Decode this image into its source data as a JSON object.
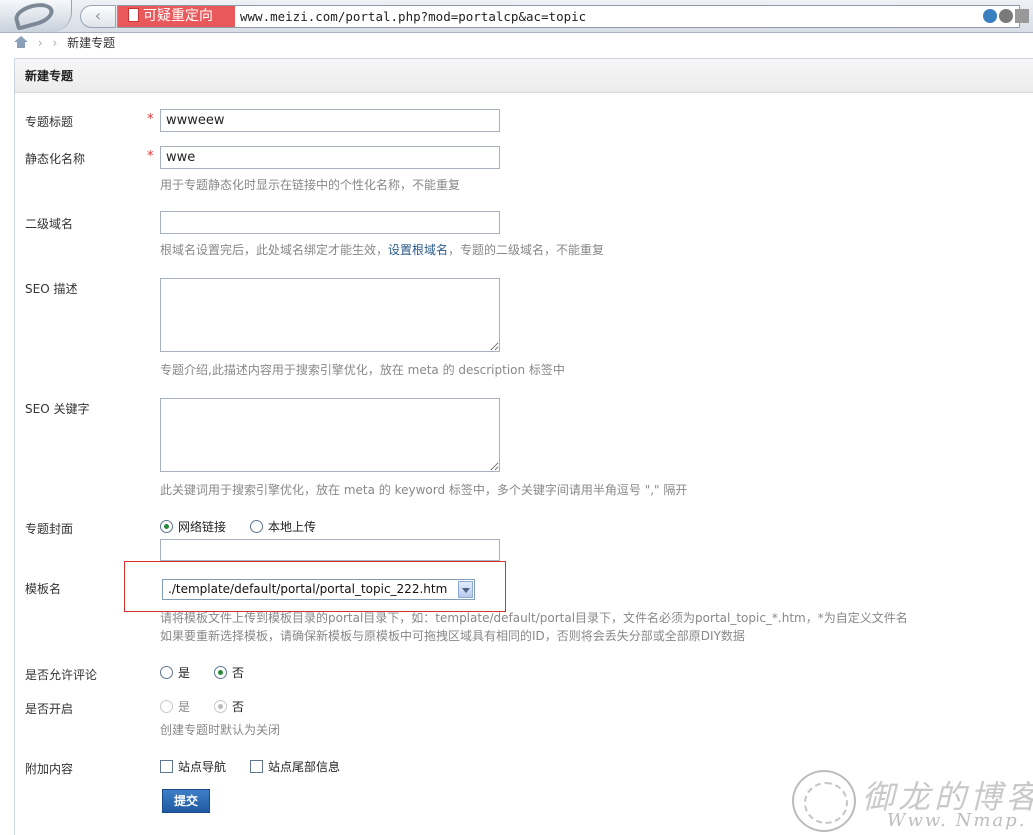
{
  "browser": {
    "warning_label": "可疑重定向",
    "url": "www.meizi.com/portal.php?mod=portalcp&ac=topic"
  },
  "breadcrumb": {
    "sep1": "›",
    "sep2": "›",
    "current": "新建专题"
  },
  "panel": {
    "title": "新建专题"
  },
  "form": {
    "title": {
      "label": "专题标题",
      "required": "*",
      "value": "wwweew"
    },
    "static_name": {
      "label": "静态化名称",
      "required": "*",
      "value": "wwe",
      "hint": "用于专题静态化时显示在链接中的个性化名称，不能重复"
    },
    "subdomain": {
      "label": "二级域名",
      "value": "",
      "hint_pre": "根域名设置完后，此处域名绑定才能生效，",
      "hint_link": "设置根域名",
      "hint_post": "，专题的二级域名，不能重复"
    },
    "seo_desc": {
      "label": "SEO 描述",
      "hint": "专题介绍,此描述内容用于搜索引擎优化，放在 meta 的 description 标签中"
    },
    "seo_keywords": {
      "label": "SEO 关键字",
      "hint": "此关键词用于搜索引擎优化，放在 meta 的 keyword 标签中，多个关键字间请用半角逗号 \",\" 隔开"
    },
    "cover": {
      "label": "专题封面",
      "opt_network": "网络链接",
      "opt_local": "本地上传",
      "value": ""
    },
    "template": {
      "label": "模板名",
      "selected": "./template/default/portal/portal_topic_222.htm",
      "hint1": "请将模板文件上传到模板目录的portal目录下，如：template/default/portal目录下，文件名必须为portal_topic_*.htm，*为自定义文件名",
      "hint2": "如果要重新选择模板，请确保新模板与原模板中可拖拽区域具有相同的ID，否则将会丢失分部或全部原DIY数据"
    },
    "allow_comment": {
      "label": "是否允许评论",
      "yes": "是",
      "no": "否"
    },
    "enabled": {
      "label": "是否开启",
      "yes": "是",
      "no": "否",
      "hint": "创建专题时默认为关闭"
    },
    "extra": {
      "label": "附加内容",
      "opt_nav": "站点导航",
      "opt_footer": "站点尾部信息"
    },
    "submit_label": "提交"
  },
  "watermark": {
    "cn": "御龙的博客",
    "en": "Www. Nmap. cc"
  },
  "colors": {
    "required": "#e53333",
    "link": "#2a5a8a",
    "submit_bg": "#2a68b0",
    "highlight_box": "#d8302f"
  }
}
